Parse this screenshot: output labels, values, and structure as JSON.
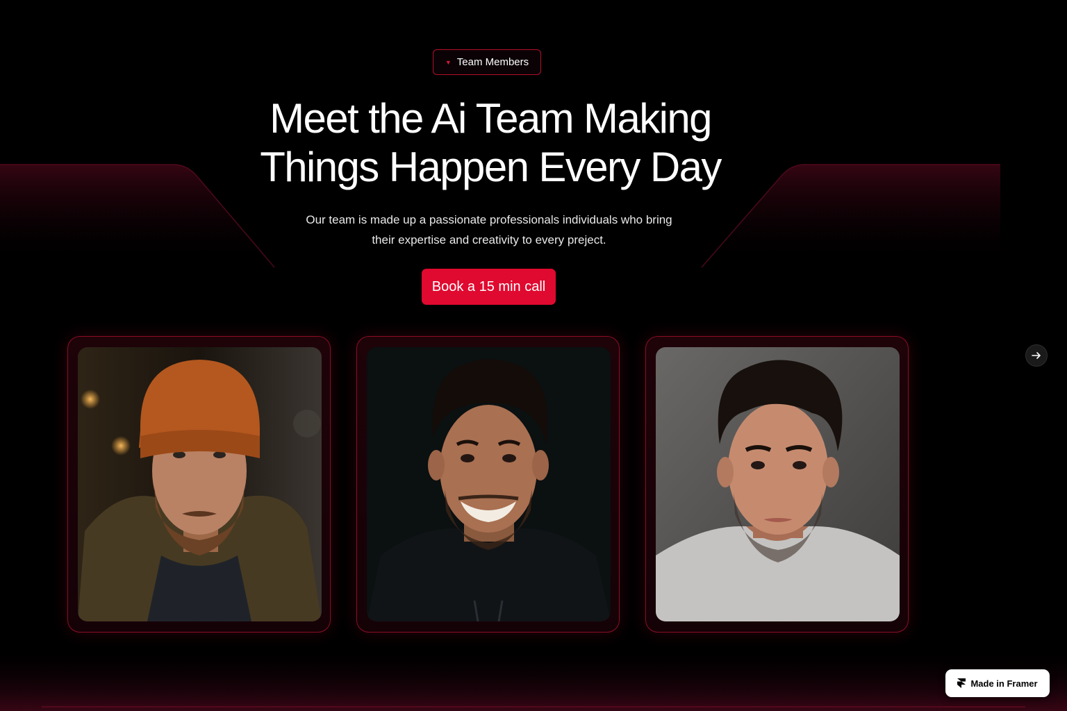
{
  "badge": {
    "label": "Team Members",
    "icon": "chevron-down-icon"
  },
  "hero": {
    "title_line1": "Meet the Ai Team Making",
    "title_line2": "Things Happen Every Day",
    "subtitle_line1": "Our team is made up a passionate professionals individuals who bring",
    "subtitle_line2": "their expertise and creativity to every preject.",
    "cta_label": "Book a 15 min call"
  },
  "team": [
    {
      "photo": "man-with-orange-beanie-portrait"
    },
    {
      "photo": "smiling-man-dark-hair-portrait"
    },
    {
      "photo": "man-grey-tshirt-portrait"
    }
  ],
  "carousel": {
    "next_icon": "arrow-right-icon"
  },
  "framer_badge": {
    "label": "Made in Framer",
    "icon": "framer-logo-icon"
  },
  "colors": {
    "accent": "#e0092f",
    "border": "#8c0e26",
    "background": "#000000"
  }
}
